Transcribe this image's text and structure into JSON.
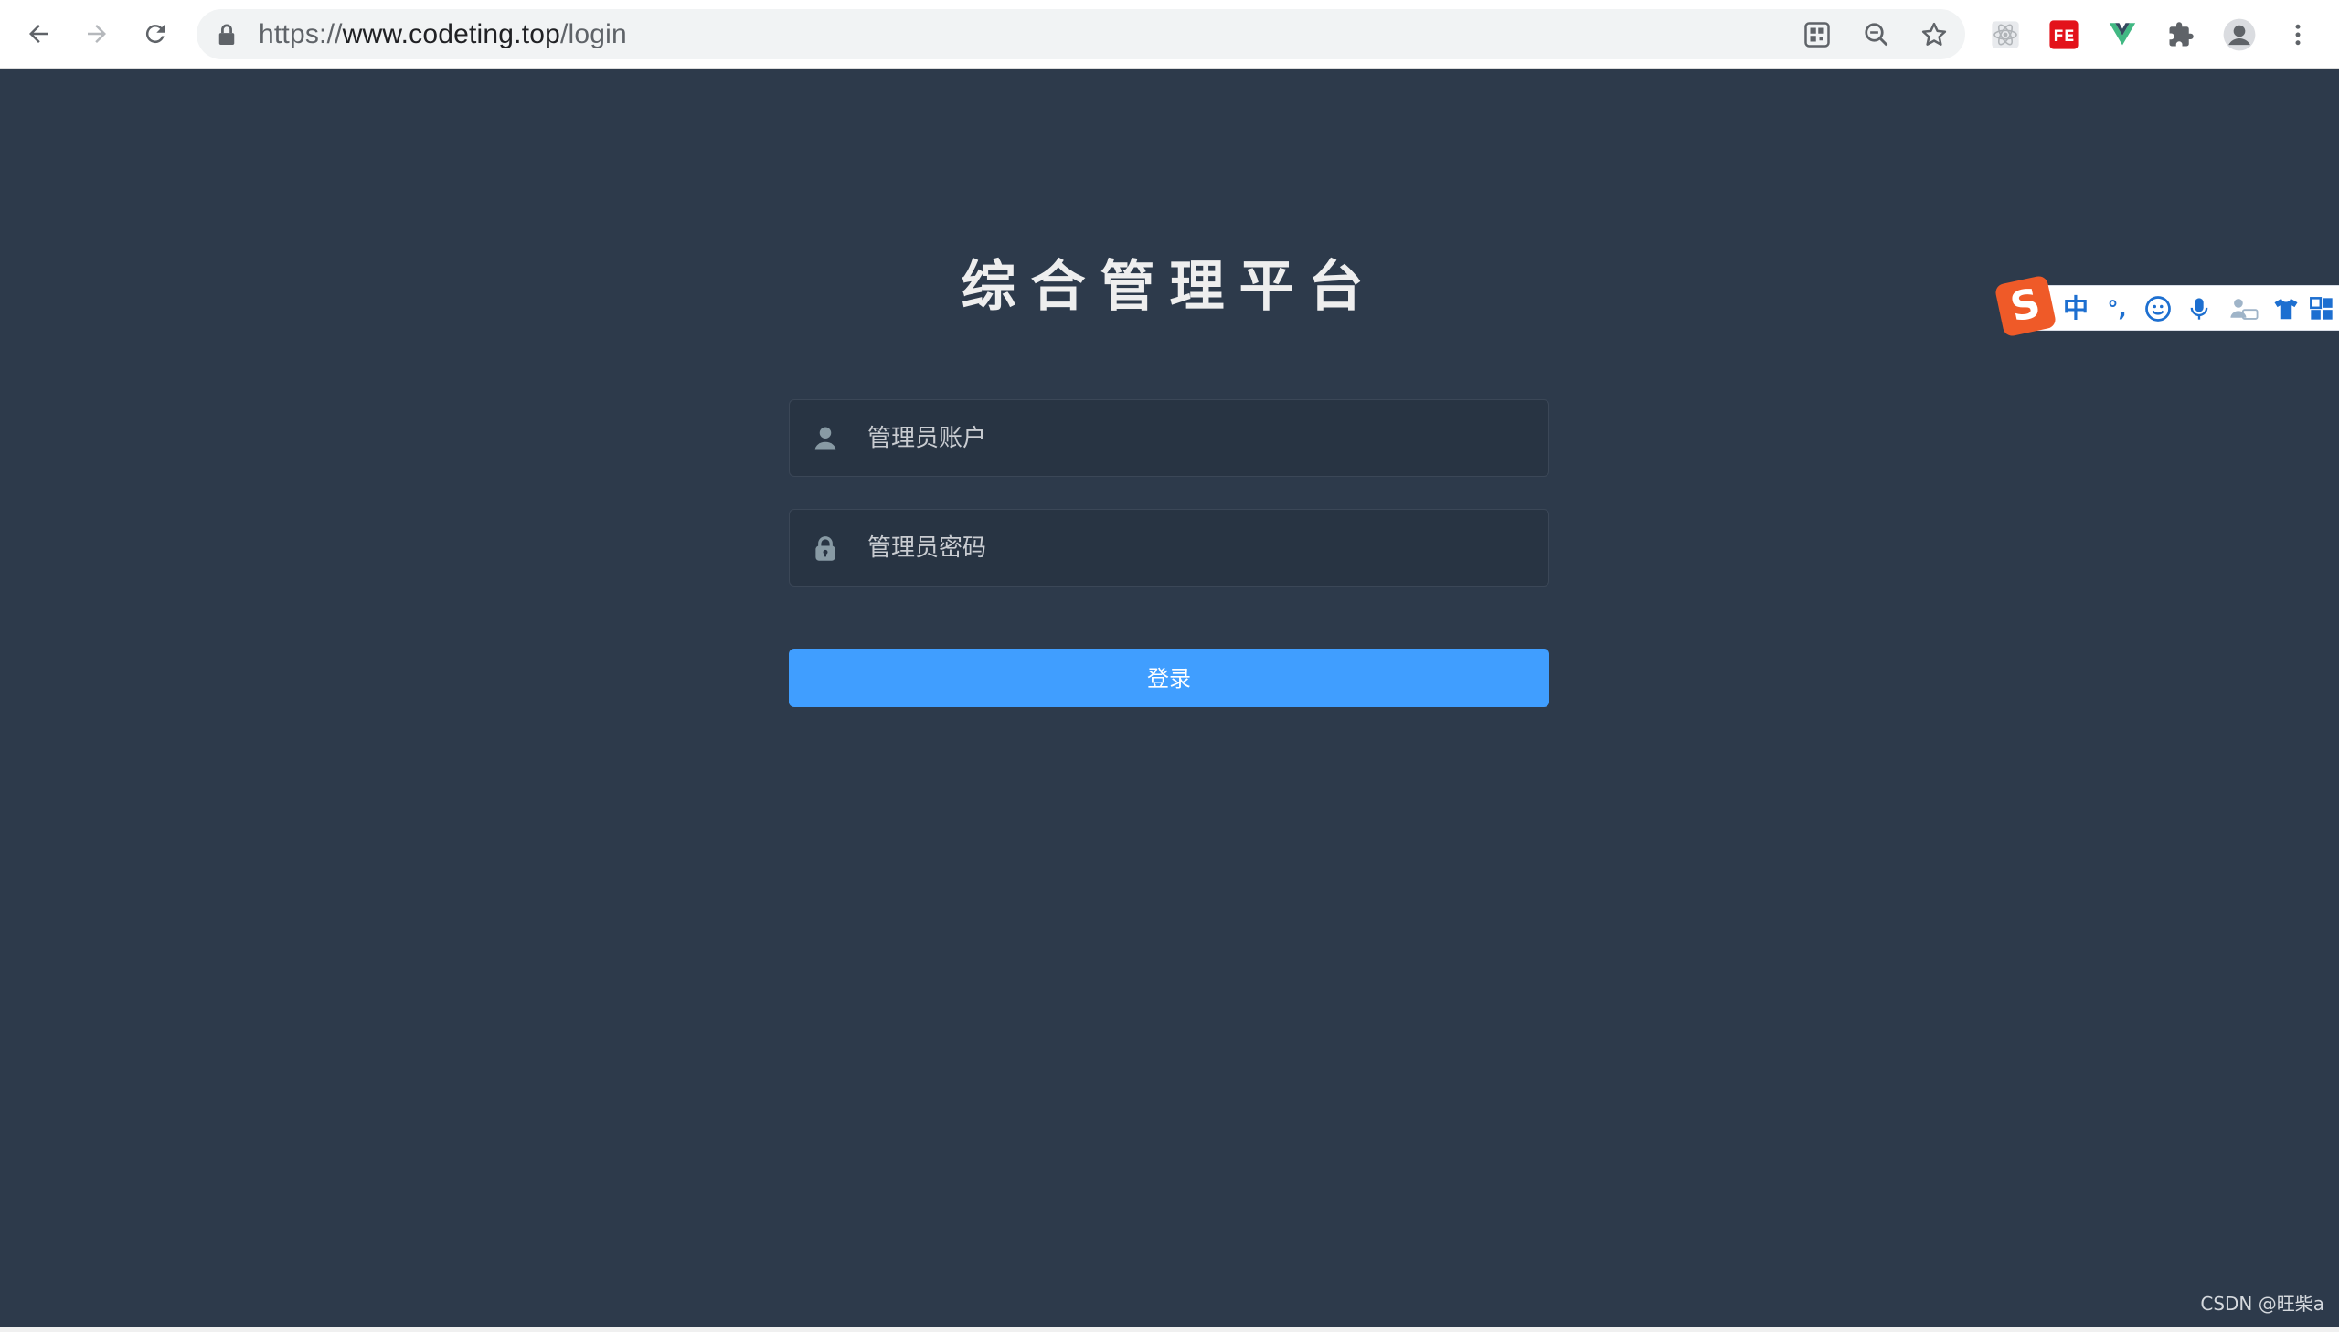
{
  "browser": {
    "url_scheme": "https://",
    "url_host": "www.codeting.top",
    "url_path": "/login"
  },
  "page": {
    "title": "综合管理平台",
    "username_placeholder": "管理员账户",
    "password_placeholder": "管理员密码",
    "login_label": "登录"
  },
  "ime": {
    "logo": "S",
    "mode": "中",
    "punct": "°,"
  },
  "watermark": "CSDN @旺柴a",
  "colors": {
    "background": "#2d3a4b",
    "input_bg": "#283443",
    "primary": "#409eff"
  }
}
